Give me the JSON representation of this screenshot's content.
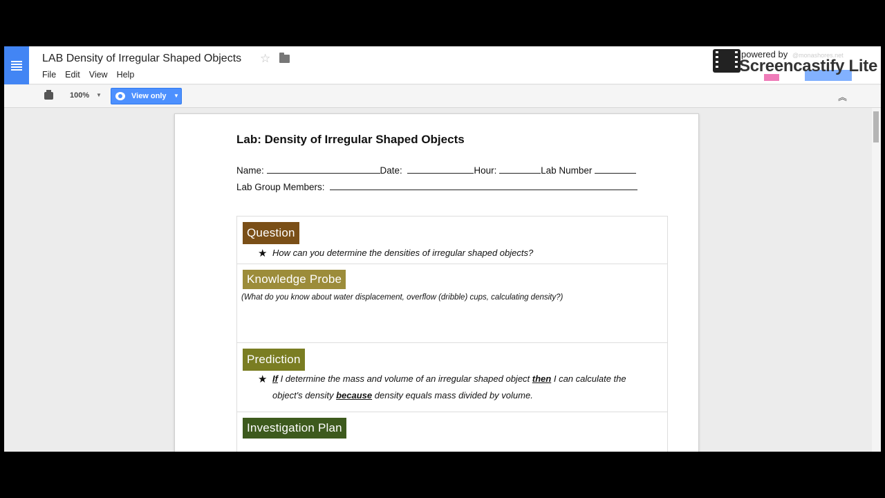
{
  "header": {
    "doc_title": "LAB Density of Irregular Shaped Objects",
    "menu": [
      "File",
      "Edit",
      "View",
      "Help"
    ],
    "screencastify_powered": "powered by",
    "screencastify_brand": "Screencastify Lite",
    "user_email": "@monashores.net"
  },
  "toolbar": {
    "zoom": "100%",
    "view_only_label": "View only"
  },
  "document": {
    "heading": "Lab: Density of Irregular Shaped Objects",
    "form": {
      "name_label": "Name:",
      "date_label": "Date:",
      "hour_label": "Hour:",
      "lab_number_label": "Lab Number",
      "group_label": "Lab Group Members:"
    },
    "sections": {
      "question": {
        "tag": "Question",
        "text": "How can you determine the densities of irregular shaped objects?"
      },
      "knowledge": {
        "tag": "Knowledge Probe",
        "text": "(What do you know about water displacement, overflow (dribble) cups, calculating density?)"
      },
      "prediction": {
        "tag": "Prediction",
        "if_word": "If",
        "part1": " I determine the mass and volume of an irregular shaped object ",
        "then_word": "then",
        "part2": " I can calculate the",
        "part3": "object's density ",
        "because_word": "because",
        "part4": " density equals mass divided by volume."
      },
      "plan": {
        "tag": "Investigation Plan"
      }
    }
  },
  "colors": {
    "docs_blue": "#4285f4",
    "question_tag": "#7a4f17",
    "knowledge_tag": "#9c8c3a",
    "prediction_tag": "#7a7d22",
    "plan_tag": "#3d5a1d"
  },
  "draw_tools": [
    "pointer-icon",
    "eraser-icon",
    "pen-icon",
    "highlighter-icon",
    "rectangle-icon",
    "close-icon"
  ]
}
